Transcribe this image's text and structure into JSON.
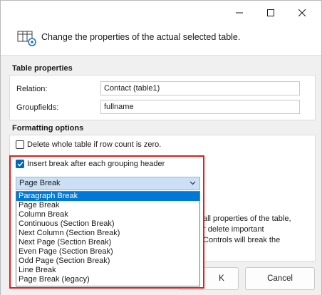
{
  "window": {
    "controls": {
      "close": "close",
      "minimize": "minimize",
      "maximize": "maximize"
    }
  },
  "header": {
    "text": "Change the properties of the actual selected table.",
    "icon": "table-settings-icon"
  },
  "table_properties": {
    "title": "Table properties",
    "relation_label": "Relation:",
    "relation_value": "Contact (table1)",
    "groupfields_label": "Groupfields:",
    "groupfields_value": "fullname"
  },
  "formatting": {
    "title": "Formatting options",
    "delete_table_label": "Delete whole table if row count is zero.",
    "delete_table_checked": false,
    "insert_break_label": "Insert break after each grouping header",
    "insert_break_checked": true,
    "break_select_value": "Page Break",
    "break_options": [
      "Paragraph Break",
      "Page Break",
      "Column Break",
      "Continuous (Section Break)",
      "Next Column (Section Break)",
      "Next Page (Section Break)",
      "Even Page (Section Break)",
      "Odd Page (Section Break)",
      "Line Break",
      "Page Break (legacy)"
    ],
    "highlighted_option": "Paragraph Break"
  },
  "partial_warning": {
    "line1": "all properties of the table,",
    "line2": "r delete important",
    "line3": "Controls will break the"
  },
  "buttons": {
    "ok": "K",
    "cancel": "Cancel"
  },
  "colors": {
    "accent": "#0067c0",
    "highlight": "#0078d7",
    "callout": "#e01e1e"
  }
}
